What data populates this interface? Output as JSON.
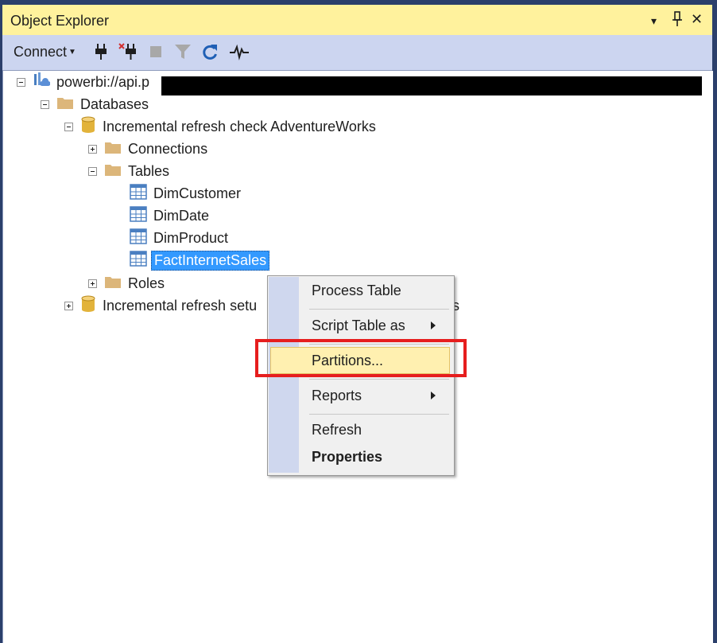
{
  "panel": {
    "title": "Object Explorer",
    "title_buttons": [
      "▾",
      "⊥",
      "✕"
    ]
  },
  "toolbar": {
    "connect_label": "Connect",
    "icons": [
      "connect-plug-icon",
      "disconnect-icon",
      "stop-icon",
      "filter-icon",
      "refresh-icon",
      "activity-monitor-icon"
    ]
  },
  "tree": {
    "server": "powerbi://api.p",
    "databases": "Databases",
    "db1": "Incremental refresh check AdventureWorks",
    "connections": "Connections",
    "tables": "Tables",
    "table_items": [
      "DimCustomer",
      "DimDate",
      "DimProduct",
      "FactInternetSales"
    ],
    "roles": "Roles",
    "db2_visible": "Incremental refresh setu",
    "db2_tail": "s"
  },
  "context_menu": {
    "items": [
      "Process Table",
      "Script Table as",
      "Partitions...",
      "Reports",
      "Refresh",
      "Properties"
    ]
  },
  "colors": {
    "titlebar": "#fff29d",
    "toolbar": "#ccd5f0",
    "selection": "#3399ff",
    "highlight_box": "#e61e1e",
    "menu_hover": "#fff0b0"
  }
}
